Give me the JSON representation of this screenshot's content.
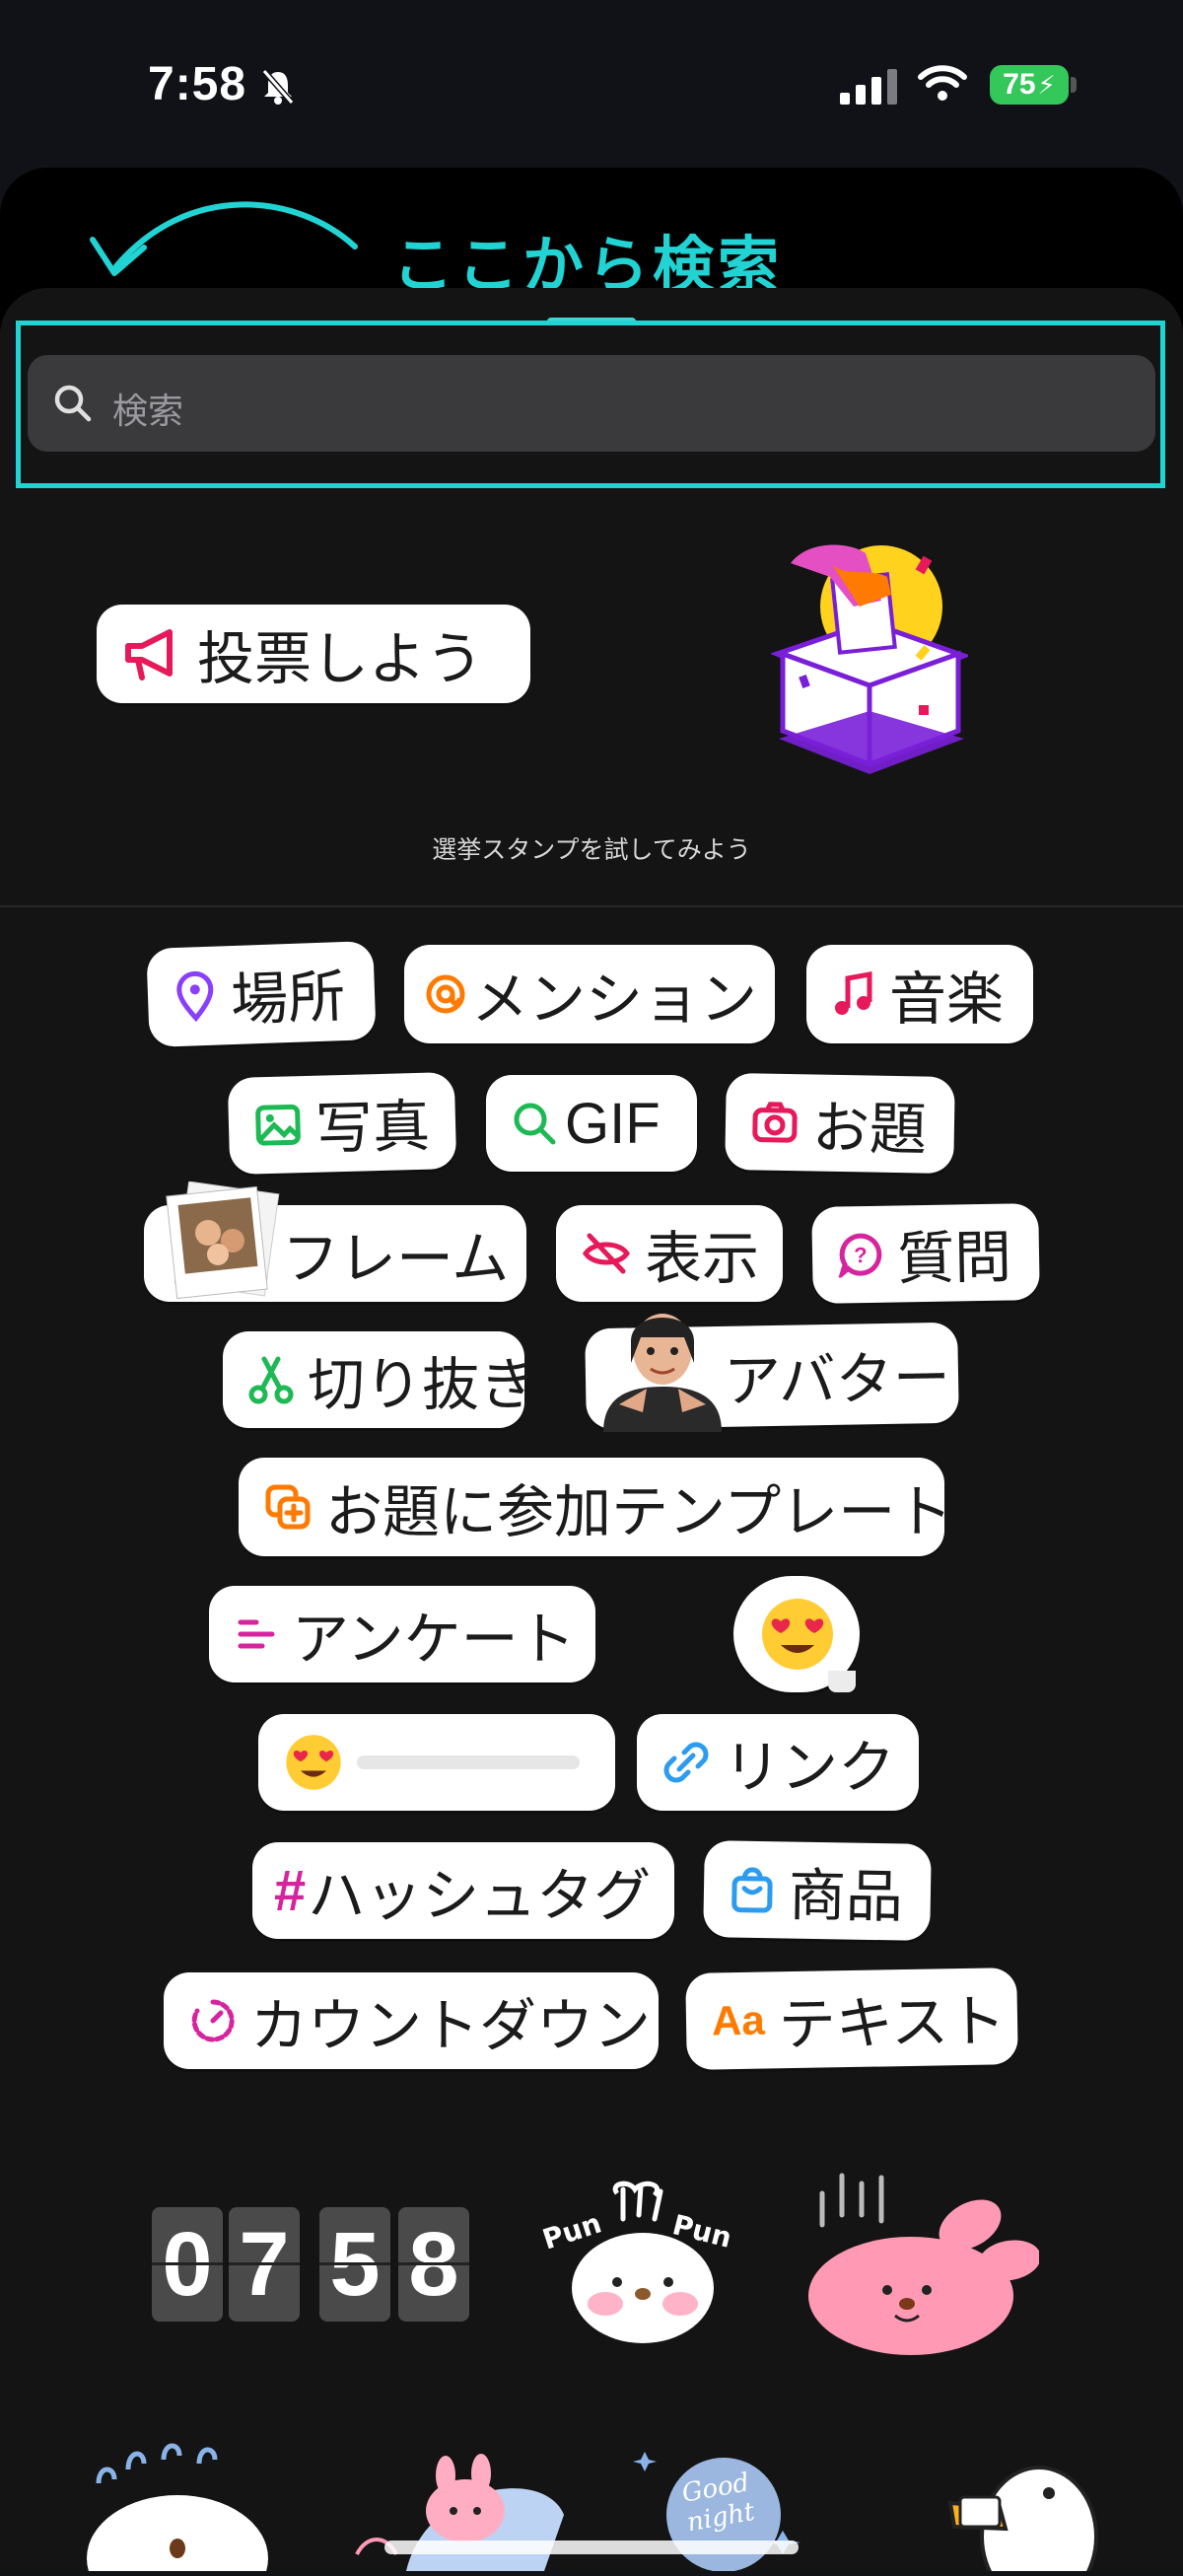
{
  "status_bar": {
    "time": "7:58",
    "battery": "75"
  },
  "annotation": {
    "text": "ここから検索"
  },
  "search": {
    "placeholder": "検索"
  },
  "promo": {
    "button_label": "投票しよう",
    "caption": "選挙スタンプを試してみよう"
  },
  "stickers": {
    "location": "場所",
    "mention": "メンション",
    "music": "音楽",
    "photo": "写真",
    "gif": "GIF",
    "topic": "お題",
    "frame": "フレーム",
    "reveal": "表示",
    "question": "質問",
    "cutout": "切り抜き",
    "avatar": "アバター",
    "add_yours_template": "お題に参加テンプレート",
    "poll": "アンケート",
    "link": "リンク",
    "hashtag": "ハッシュタグ",
    "product": "商品",
    "countdown": "カウントダウン",
    "text": "テキスト",
    "text_icon": "Aa"
  },
  "clock_sticker": {
    "digits": [
      "0",
      "7",
      "5",
      "8"
    ]
  },
  "art_stickers": {
    "pun_left": "Pun",
    "pun_right": "Pun",
    "good_night": "Good night"
  },
  "colors": {
    "accent_cyan": "#22d3d3",
    "background": "#141414",
    "pill": "#ffffff"
  }
}
